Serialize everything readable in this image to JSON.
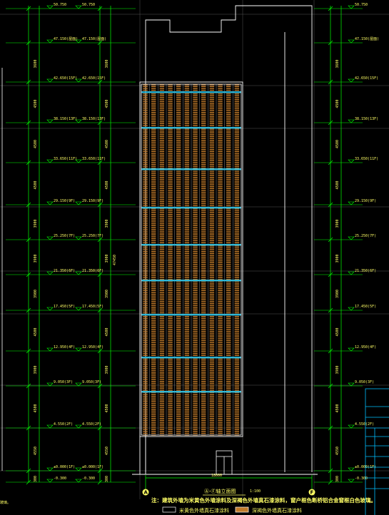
{
  "levels": [
    {
      "label_outer": "50.750",
      "label_inner": "50.750"
    },
    {
      "label_outer": "47.150(屋面)",
      "label_inner": "47.150(屋面)"
    },
    {
      "label_outer": "42.650(15F)",
      "label_inner": "42.650(15F)"
    },
    {
      "label_outer": "38.150(13F)",
      "label_inner": "38.150(13F)"
    },
    {
      "label_outer": "33.650(11F)",
      "label_inner": "33.650(11F)"
    },
    {
      "label_outer": "29.150(9F)",
      "label_inner": "29.150(9F)"
    },
    {
      "label_outer": "25.250(7F)",
      "label_inner": "25.250(7F)"
    },
    {
      "label_outer": "21.350(6F)",
      "label_inner": "21.350(6F)"
    },
    {
      "label_outer": "17.450(5F)",
      "label_inner": "17.450(5F)"
    },
    {
      "label_outer": "12.950(4F)",
      "label_inner": "12.950(4F)"
    },
    {
      "label_outer": "9.050(3F)",
      "label_inner": "9.050(3F)"
    },
    {
      "label_outer": "4.550(2F)",
      "label_inner": "4.550(2F)"
    },
    {
      "label_outer": "±0.000(1F)",
      "label_inner": "±0.000(1F)"
    },
    {
      "label_outer": "-0.300",
      "label_inner": "-0.300"
    }
  ],
  "right_levels": [
    "50.750",
    "47.150(屋面)",
    "42.650(15F)",
    "38.150(13F)",
    "33.650(11F)",
    "29.150(9F)",
    "25.250(7F)",
    "21.350(6F)",
    "17.450(5F)",
    "12.950(4F)",
    "9.050(3F)",
    "4.550(2F)",
    "±0.000(1F)",
    "-0.300"
  ],
  "dims": [
    "3600",
    "4500",
    "4500",
    "4500",
    "3900",
    "3900",
    "3900",
    "4500",
    "3900",
    "4500",
    "4550",
    "300"
  ],
  "total_dim": "47450",
  "width_dim": "18000",
  "axis_left": "A",
  "axis_right": "F",
  "title": "Ⓐ-Ⓕ轴立面图",
  "scale": "1:100",
  "note": "注：建筑外墙为米黄色外墙涂料及深褐色外墙真石漆涂料，窗户框色断桥铝合金窗框白色玻璃。",
  "left_fragment": "玻璃。",
  "legend": [
    {
      "label": "米黄色外墙真石漆涂料",
      "color": "#000000"
    },
    {
      "label": "深褐色外墙真石漆涂料",
      "color": "#c07a2a"
    }
  ],
  "colors": {
    "dim_line": "#00ff00",
    "building": "#ffffff",
    "text": "#ffff66",
    "window_stripe": "#c07a2a",
    "floor_band": "#2fb7d6",
    "grid": "#666666",
    "title_block": "#00bfff"
  }
}
